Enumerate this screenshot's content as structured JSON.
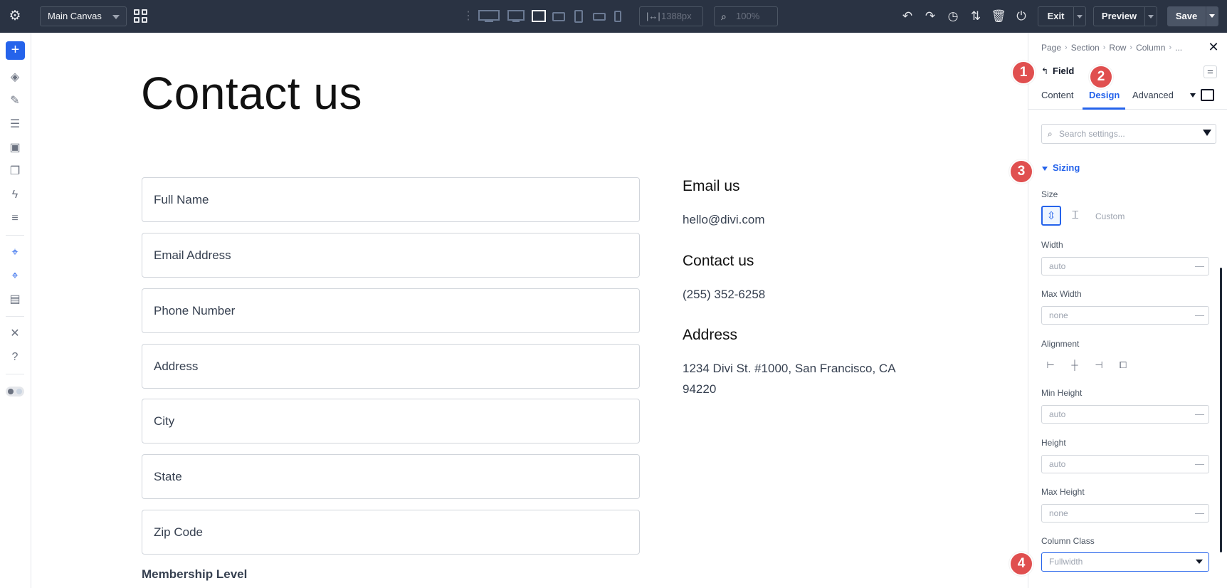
{
  "topbar": {
    "canvas_select": "Main Canvas",
    "width_value": "1388px",
    "zoom_value": "100%",
    "exit_label": "Exit",
    "preview_label": "Preview",
    "save_label": "Save",
    "icons": [
      "gear-icon",
      "grid-icon",
      "undo-icon",
      "redo-icon",
      "history-icon",
      "sort-icon",
      "trash-icon",
      "power-icon"
    ]
  },
  "canvas": {
    "title": "Contact us",
    "fields": [
      "Full Name",
      "Email Address",
      "Phone Number",
      "Address",
      "City",
      "State",
      "Zip Code"
    ],
    "membership_label": "Membership Level",
    "info": [
      {
        "heading": "Email us",
        "text": "hello@divi.com"
      },
      {
        "heading": "Contact us",
        "text": "(255) 352-6258"
      },
      {
        "heading": "Address",
        "text": "1234 Divi St. #1000, San Francisco, CA 94220"
      }
    ]
  },
  "panel": {
    "breadcrumb": [
      "Page",
      "Section",
      "Row",
      "Column",
      "..."
    ],
    "field_title": "Field",
    "tabs": [
      "Content",
      "Design",
      "Advanced"
    ],
    "active_tab": "Design",
    "search_placeholder": "Search settings...",
    "section_title": "Sizing",
    "size_label": "Size",
    "size_custom": "Custom",
    "width_label": "Width",
    "width_value": "auto",
    "max_width_label": "Max Width",
    "max_width_value": "none",
    "alignment_label": "Alignment",
    "min_height_label": "Min Height",
    "min_height_value": "auto",
    "height_label": "Height",
    "height_value": "auto",
    "max_height_label": "Max Height",
    "max_height_value": "none",
    "column_class_label": "Column Class",
    "column_class_value": "Fullwidth"
  },
  "badges": [
    "1",
    "2",
    "3",
    "4"
  ],
  "colors": {
    "topbar_bg": "#2a3343",
    "accent": "#2563eb",
    "badge": "#e04f4f"
  }
}
